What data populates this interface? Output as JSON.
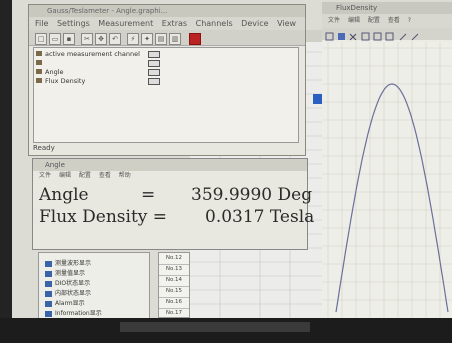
{
  "main_window": {
    "title": "Gauss/Teslameter - Angle.graphi...",
    "menu": [
      "File",
      "Settings",
      "Measurement",
      "Extras",
      "Channels",
      "Device",
      "View",
      "?"
    ],
    "channels": [
      {
        "label": "active measurement channel"
      },
      {
        "label": ""
      },
      {
        "label": "Angle"
      },
      {
        "label": "Flux Density"
      }
    ],
    "status": "Ready"
  },
  "plot_window": {
    "title": "FluxDensity",
    "menu": [
      "文件",
      "编辑",
      "配置",
      "查看",
      "?"
    ],
    "curve_color": "#6a6f9a"
  },
  "angle_window": {
    "title": "Angle",
    "menu": [
      "文件",
      "编辑",
      "配置",
      "查看",
      "帮助"
    ],
    "readouts": [
      {
        "label": "Angle",
        "equals": "=",
        "value": "359.9990 Deg"
      },
      {
        "label": "Flux Density =",
        "equals": "",
        "value": "0.0317 Tesla"
      }
    ]
  },
  "lower_panel": {
    "items": [
      "测量波形显示",
      "测量值显示",
      "DIO状态显示",
      "内部状态显示",
      "Alarm显示",
      "Information显示"
    ]
  },
  "row_table": {
    "rows": [
      "No.12",
      "No.13",
      "No.14",
      "No.15",
      "No.16",
      "No.17"
    ]
  }
}
